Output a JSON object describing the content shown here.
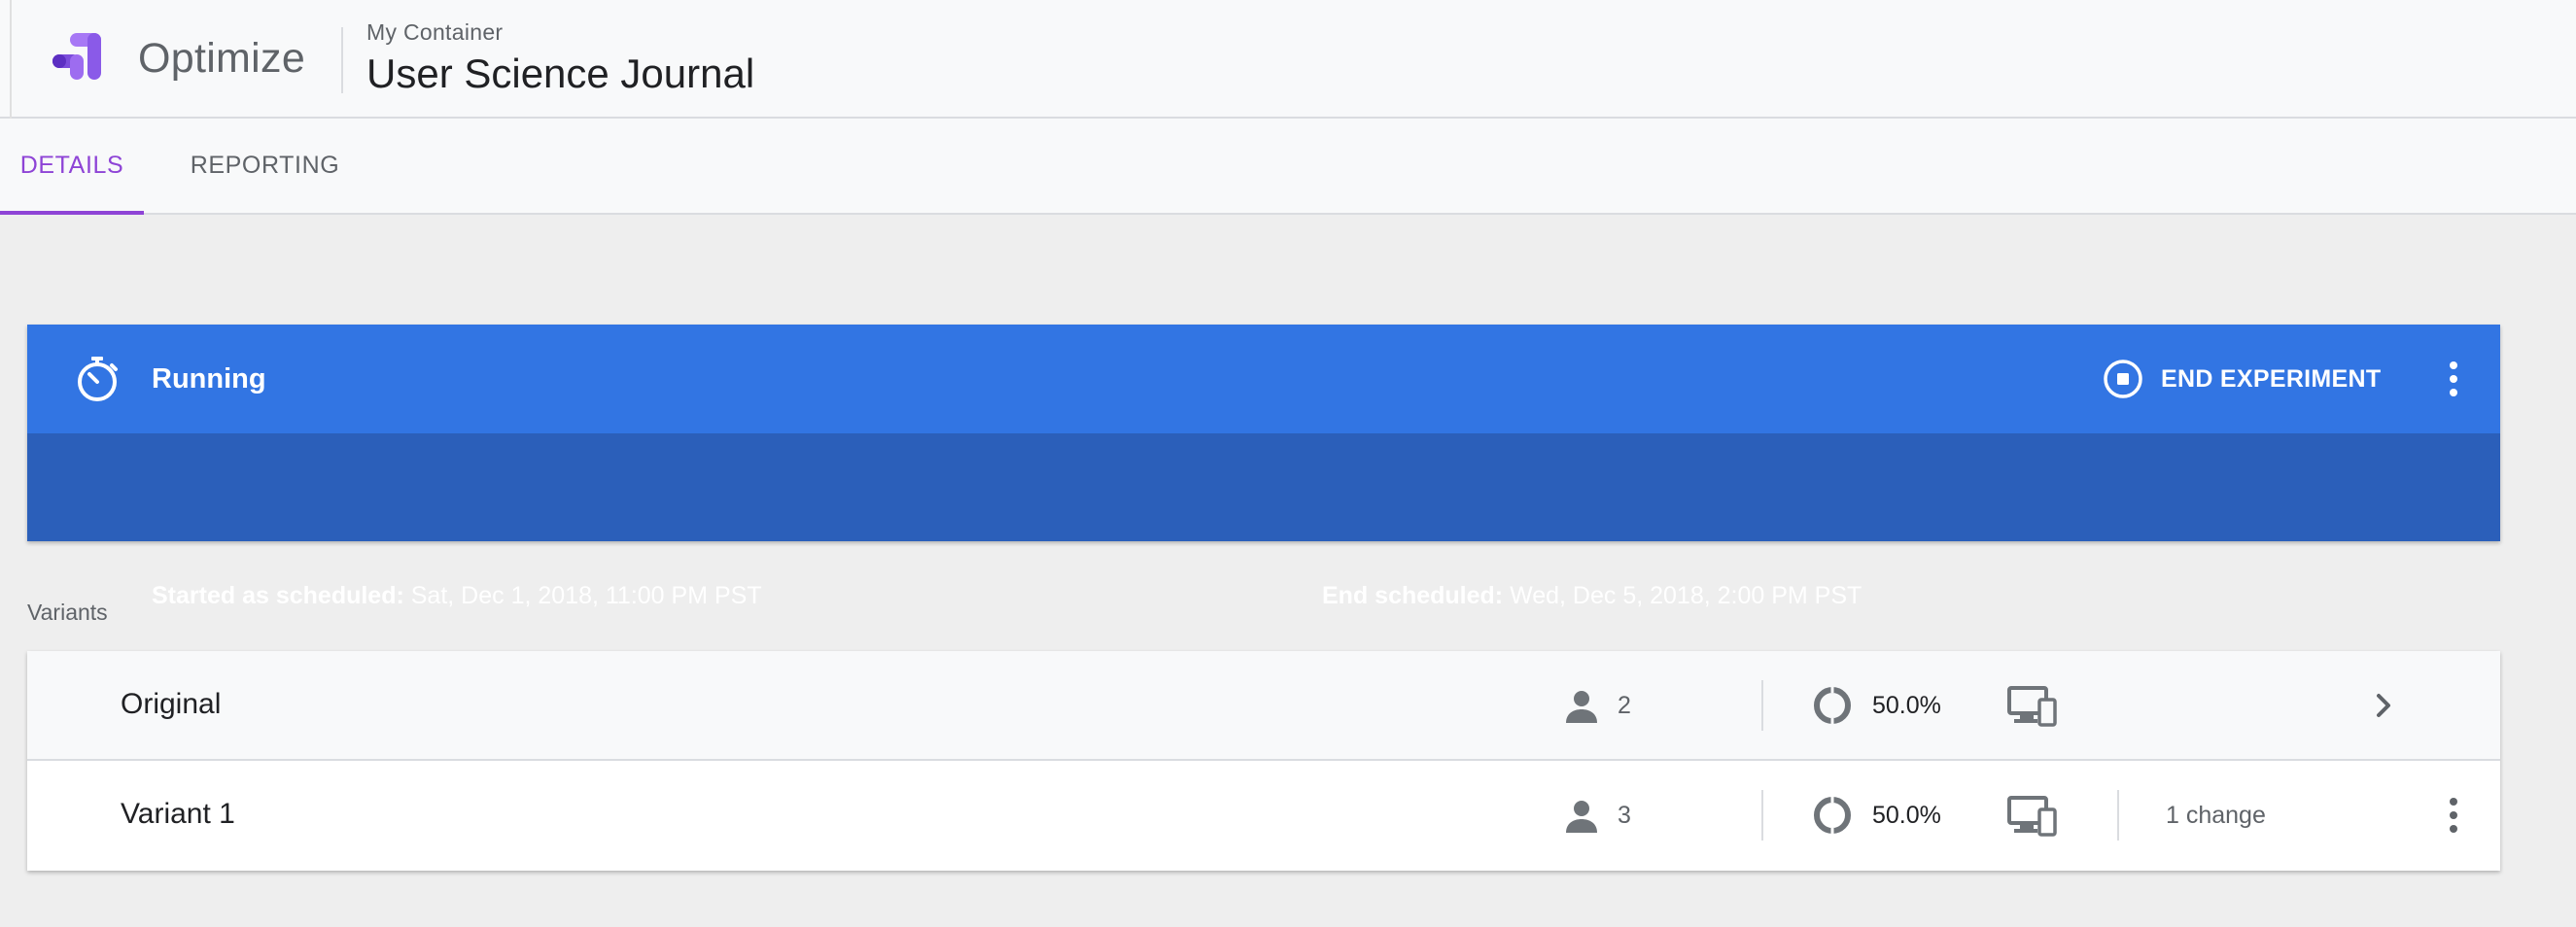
{
  "header": {
    "product_name": "Optimize",
    "container_label": "My Container",
    "experiment_title": "User Science Journal",
    "logo_colors": [
      "#7b4ddb",
      "#a778f5",
      "#5c2fc2"
    ]
  },
  "tabs": [
    {
      "label": "DETAILS",
      "active": true
    },
    {
      "label": "REPORTING",
      "active": false
    }
  ],
  "status": {
    "state": "Running",
    "end_button_label": "END EXPERIMENT",
    "started_label": "Started as scheduled:",
    "started_value": " Sat, Dec 1, 2018, 11:00 PM PST",
    "end_label": "End scheduled:",
    "end_value": " Wed, Dec 5, 2018, 2:00 PM PST",
    "colors": {
      "bar": "#3275e3",
      "detail": "#2b5fba"
    }
  },
  "variants": {
    "section_label": "Variants",
    "rows": [
      {
        "name": "Original",
        "sessions": "2",
        "weight": "50.0%",
        "changes": "",
        "action_icon": "chevron-right-icon"
      },
      {
        "name": "Variant 1",
        "sessions": "3",
        "weight": "50.0%",
        "changes": "1 change",
        "action_icon": "more-vert-icon"
      }
    ]
  },
  "accent_color": "#8e44d6"
}
